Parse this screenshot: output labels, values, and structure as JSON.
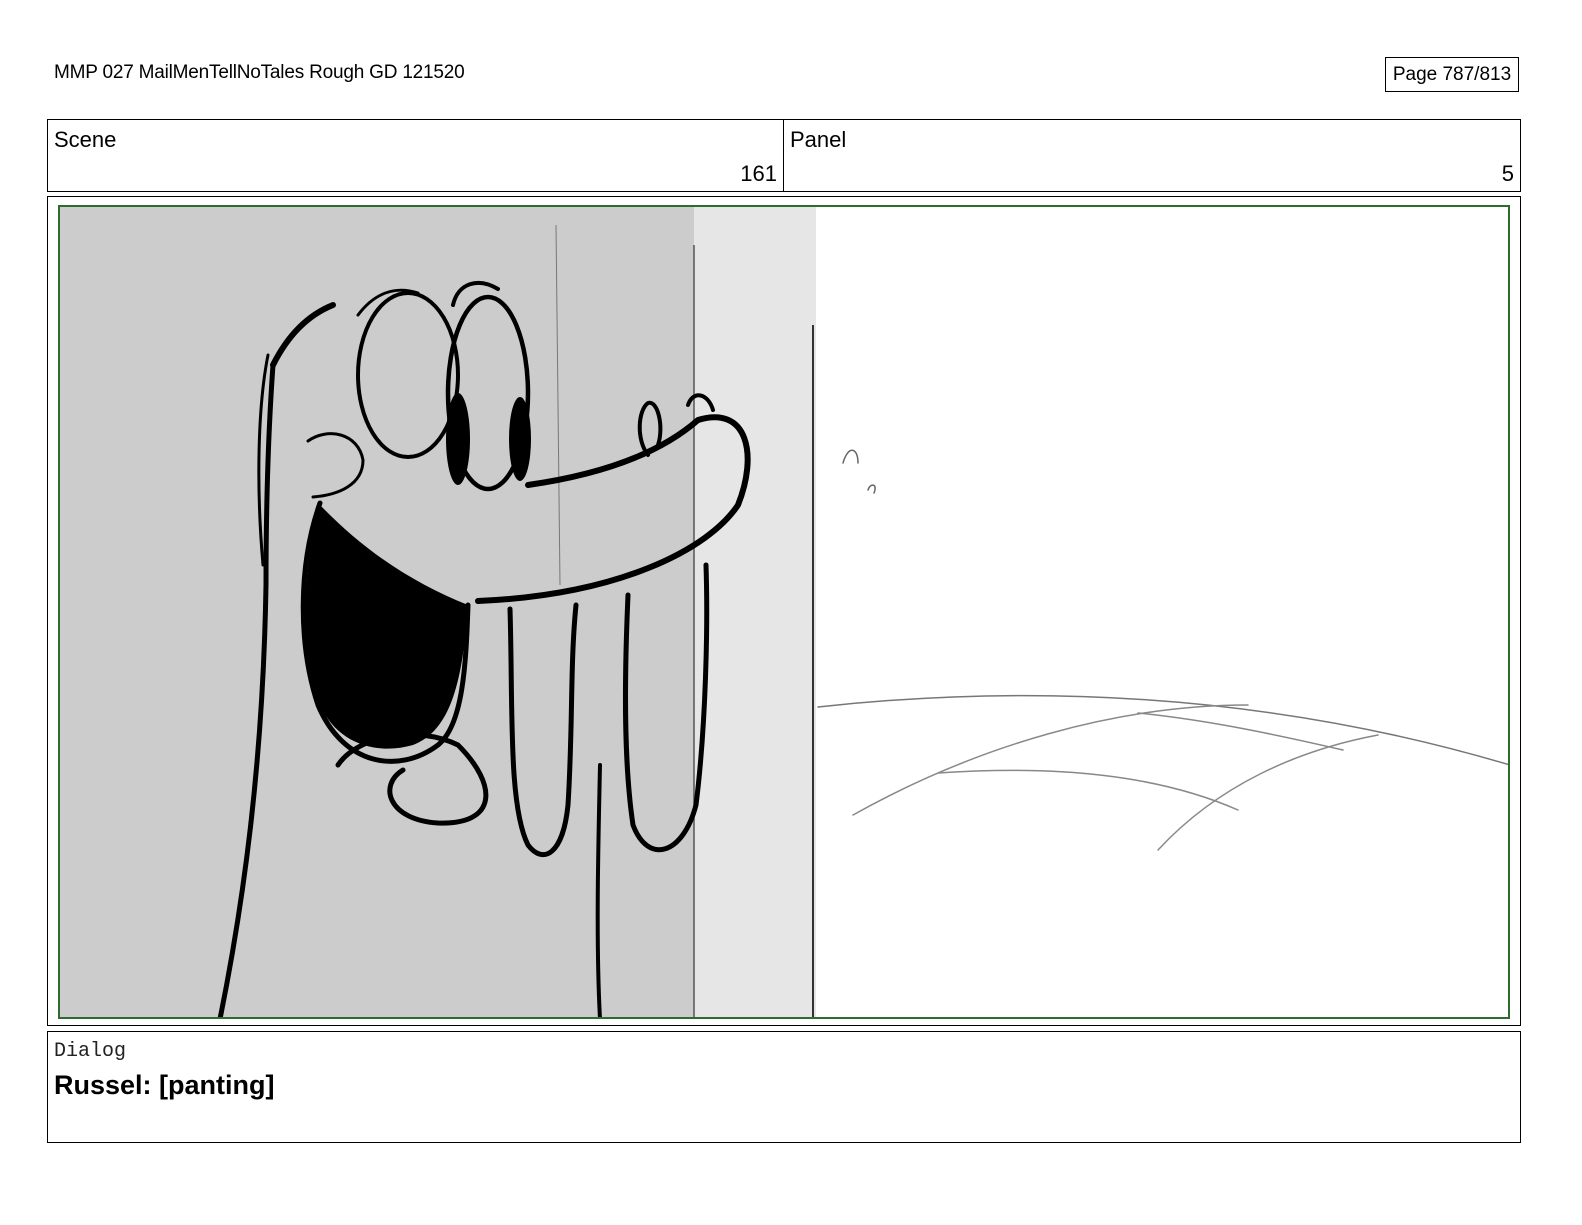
{
  "header": {
    "document_title": "MMP 027 MailMenTellNoTales Rough GD 121520",
    "page_label": "Page 787/813"
  },
  "info": {
    "scene_label": "Scene",
    "scene_value": "161",
    "panel_label": "Panel",
    "panel_value": "5"
  },
  "dialog": {
    "label": "Dialog",
    "text": "Russel: [panting]"
  },
  "colors": {
    "safe_frame_border": "#2e6b2e",
    "character_shade": "#cccccc",
    "wall_shade": "#e6e6e6",
    "background": "#ffffff"
  },
  "artwork": {
    "subject": "storyboard-sketch-character-panting-behind-wall"
  }
}
